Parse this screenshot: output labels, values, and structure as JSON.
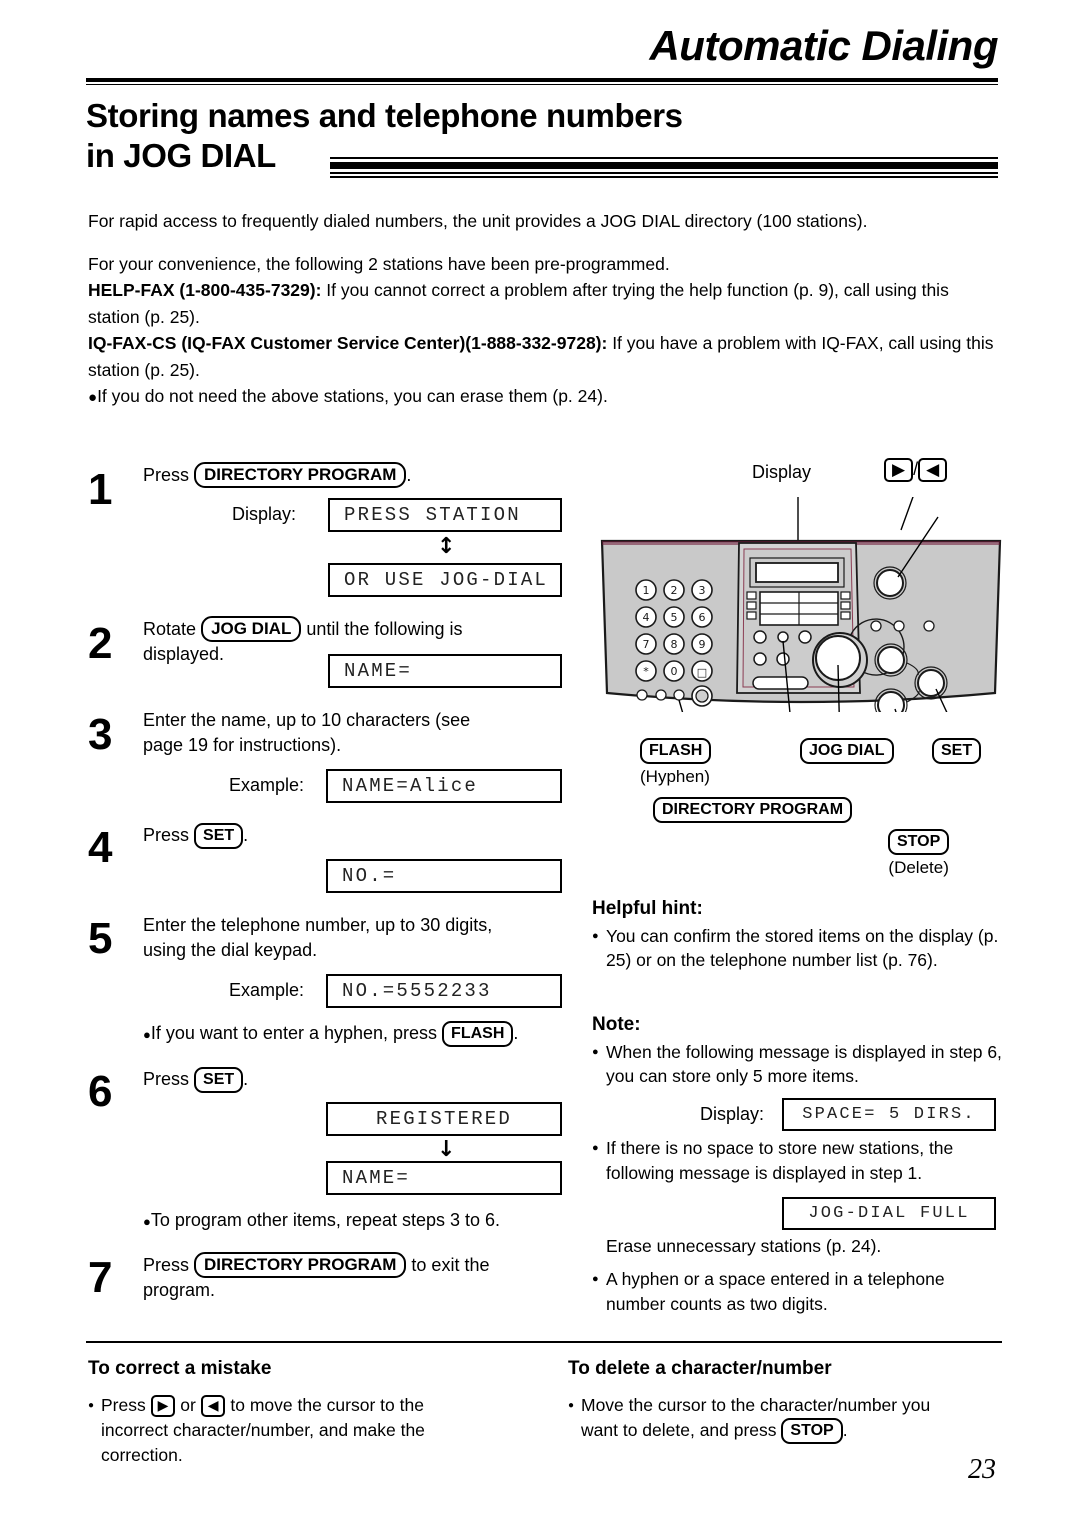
{
  "header": {
    "chapter_title": "Automatic Dialing",
    "section_title_line1": "Storing names and telephone numbers",
    "section_title_line2": "in JOG DIAL"
  },
  "intro": {
    "para1": "For rapid access to frequently dialed numbers, the unit provides a JOG DIAL directory (100 stations).",
    "para2": "For your convenience, the following 2 stations have been pre-programmed.",
    "helpfax_bold": "HELP-FAX (1-800-435-7329):",
    "helpfax_rest": " If you cannot correct a problem after trying the help function (p. 9), call using this station (p. 25).",
    "iqfax_bold": "IQ-FAX-CS (IQ-FAX Customer Service Center)(1-888-332-9728):",
    "iqfax_rest": " If you have a problem with IQ-FAX, call using this station (p. 25).",
    "bullet1": "If you do not need the above stations, you can erase them (p. 24)."
  },
  "steps": {
    "s1": {
      "num": "1",
      "press_word": "Press",
      "key": "DIRECTORY PROGRAM",
      "period": ".",
      "display_label": "Display:",
      "lcd1": "PRESS STATION",
      "lcd2": "OR USE JOG-DIAL",
      "arrow": "↕"
    },
    "s2": {
      "num": "2",
      "rotate_word": "Rotate",
      "key": "JOG DIAL",
      "tail_line1": "until the following is",
      "tail_line2": "displayed.",
      "lcd": "NAME="
    },
    "s3": {
      "num": "3",
      "line1": "Enter the name, up to 10 characters (see",
      "line2": "page 19 for instructions).",
      "example_label": "Example:",
      "lcd": "NAME=Alice"
    },
    "s4": {
      "num": "4",
      "press_word": "Press",
      "key": "SET",
      "period": ".",
      "lcd": "NO.="
    },
    "s5": {
      "num": "5",
      "line1": "Enter the telephone number, up to 30 digits,",
      "line2": "using the dial keypad.",
      "example_label": "Example:",
      "lcd": "NO.=5552233",
      "bullet_pre": "If you want to enter a hyphen, press",
      "bullet_key": "FLASH",
      "bullet_post": "."
    },
    "s6": {
      "num": "6",
      "press_word": "Press",
      "key": "SET",
      "period": ".",
      "lcd1": "REGISTERED",
      "lcd2": "NAME=",
      "arrow": "↓",
      "bullet": "To program other items, repeat steps 3 to 6."
    },
    "s7": {
      "num": "7",
      "press_word": "Press",
      "key": "DIRECTORY PROGRAM",
      "tail_line1": "to exit the",
      "tail_line2": "program."
    }
  },
  "device": {
    "display_label": "Display",
    "arrow_right": "▶",
    "slash": "/",
    "arrow_left": "◀",
    "keypad": [
      "1",
      "2",
      "3",
      "4",
      "5",
      "6",
      "7",
      "8",
      "9",
      "∗",
      "0",
      "□"
    ],
    "callouts": {
      "flash": "FLASH",
      "flash_sub": "(Hyphen)",
      "jog_dial": "JOG DIAL",
      "set": "SET",
      "directory_program": "DIRECTORY PROGRAM",
      "stop": "STOP",
      "stop_sub": "(Delete)"
    }
  },
  "helpful_hint": {
    "heading": "Helpful hint:",
    "bullet1": "You can confirm the stored items on the display (p. 25) or on the telephone number list (p. 76)."
  },
  "note": {
    "heading": "Note:",
    "bullet1": "When the following message is displayed in step 6, you can store only 5 more items.",
    "display_label": "Display:",
    "lcd_space": "SPACE= 5 DIRS.",
    "bullet2": "If there is no space to store new stations, the following message is displayed in step 1.",
    "lcd_full": "JOG-DIAL FULL",
    "erase_text": "Erase unnecessary stations (p. 24).",
    "bullet3": "A hyphen or a space entered in a telephone number counts as two digits."
  },
  "bottom": {
    "left": {
      "heading": "To correct a mistake",
      "pre": "Press",
      "key_right": "▶",
      "or": "or",
      "key_left": "◀",
      "post_line1": "to move the cursor to the",
      "post_line2": "incorrect character/number, and make the",
      "post_line3": "correction."
    },
    "right": {
      "heading": "To delete a character/number",
      "line1": "Move the cursor to the character/number you",
      "line2_pre": "want to delete, and press",
      "key": "STOP",
      "line2_post": "."
    }
  },
  "page_number": "23"
}
